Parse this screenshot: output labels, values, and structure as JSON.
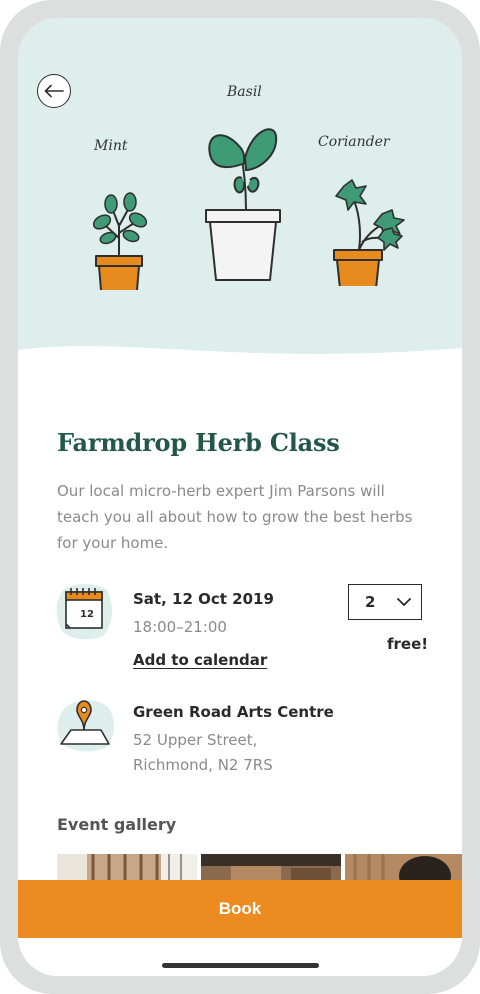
{
  "hero": {
    "plants": [
      {
        "name": "Mint",
        "pot_color": "#e88b1e"
      },
      {
        "name": "Basil",
        "pot_color": "#f4f4f4"
      },
      {
        "name": "Coriander",
        "pot_color": "#e88b1e"
      }
    ],
    "background": "#ddeeed",
    "leaf_color": "#3f9a76",
    "back_icon": "arrow-left-icon"
  },
  "event": {
    "title": "Farmdrop Herb Class",
    "description": "Our local micro-herb expert Jim Parsons will teach you all about how to grow the best herbs for your home.",
    "date": {
      "icon": "calendar-icon",
      "calendar_day": "12",
      "label": "Sat, 12 Oct 2019",
      "time": "18:00–21:00",
      "add_to_calendar": "Add to calendar"
    },
    "tickets": {
      "quantity": "2",
      "price": "free!"
    },
    "location": {
      "icon": "map-pin-icon",
      "venue": "Green Road Arts Centre",
      "address_line1": "52 Upper Street,",
      "address_line2": "Richmond, N2 7RS"
    }
  },
  "gallery": {
    "title": "Event gallery"
  },
  "footer": {
    "book_label": "Book",
    "accent": "#ec8b1f",
    "title_color": "#22574a"
  }
}
